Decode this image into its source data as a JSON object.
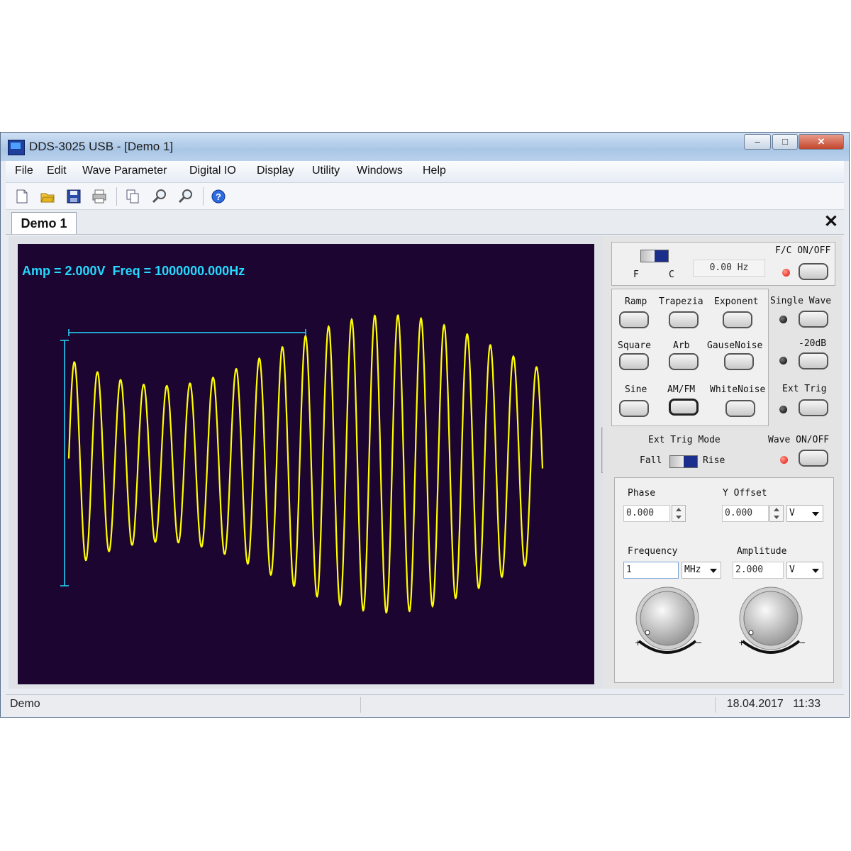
{
  "window": {
    "title": "DDS-3025 USB - [Demo 1]",
    "minimize": "–",
    "maximize": "□",
    "close": "✕"
  },
  "menu": [
    "File",
    "Edit",
    "Wave Parameter",
    "Digital IO",
    "Display",
    "Utility",
    "Windows",
    "Help"
  ],
  "toolbar": {
    "icons": [
      "new-icon",
      "open-icon",
      "save-icon",
      "print-icon",
      "copy-icon",
      "zoom-in-icon",
      "zoom-out-icon",
      "help-icon"
    ]
  },
  "tab": {
    "label": "Demo 1",
    "close": "✕"
  },
  "scope": {
    "readout": "Amp = 2.000V  Freq = 1000000.000Hz",
    "trace_color": "#ffff00",
    "marker_color": "#25d9ff",
    "background": "#1c0530"
  },
  "fc": {
    "switch_left": "F",
    "switch_right": "C",
    "counter_value": "0.00 Hz",
    "onoff_label": "F/C ON/OFF"
  },
  "waves": {
    "ramp": "Ramp",
    "trapezia": "Trapezia",
    "exponent": "Exponent",
    "square": "Square",
    "arb": "Arb",
    "gausenoise": "GauseNoise",
    "sine": "Sine",
    "amfm": "AM/FM",
    "whitenoise": "WhiteNoise"
  },
  "options": {
    "single_wave": "Single Wave",
    "minus20db": "-20dB",
    "ext_trig": "Ext Trig"
  },
  "trig_mode": {
    "label": "Ext Trig Mode",
    "fall": "Fall",
    "rise": "Rise"
  },
  "wave_onoff": "Wave ON/OFF",
  "params": {
    "phase_label": "Phase",
    "phase_value": "0.000",
    "yoffset_label": "Y Offset",
    "yoffset_value": "0.000",
    "yoffset_unit": "V",
    "frequency_label": "Frequency",
    "frequency_value": "1",
    "frequency_unit": "MHz",
    "amplitude_label": "Amplitude",
    "amplitude_value": "2.000",
    "amplitude_unit": "V"
  },
  "status": {
    "left": "Demo",
    "date": "18.04.2017",
    "time": "11:33"
  }
}
